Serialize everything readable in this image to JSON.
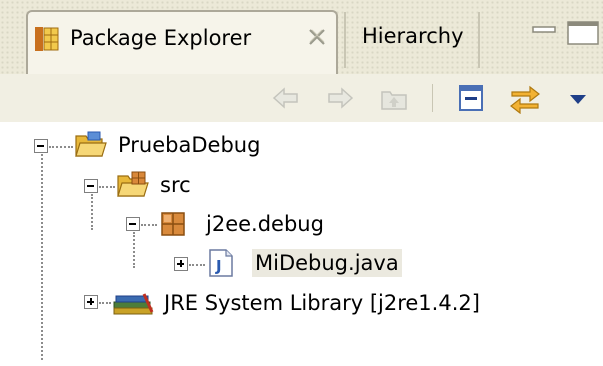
{
  "tabs": {
    "package_explorer": "Package Explorer",
    "hierarchy": "Hierarchy"
  },
  "tree": {
    "project": "PruebaDebug",
    "src": "src",
    "package": "j2ee.debug",
    "file": "MiDebug.java",
    "jre": "JRE System Library [j2re1.4.2]"
  },
  "colors": {
    "tab_bg": "#ece9d8",
    "folder": "#f2c94c",
    "package": "#b5651d",
    "java_file": "#2a5ab0",
    "library": "#5a7a3a"
  }
}
